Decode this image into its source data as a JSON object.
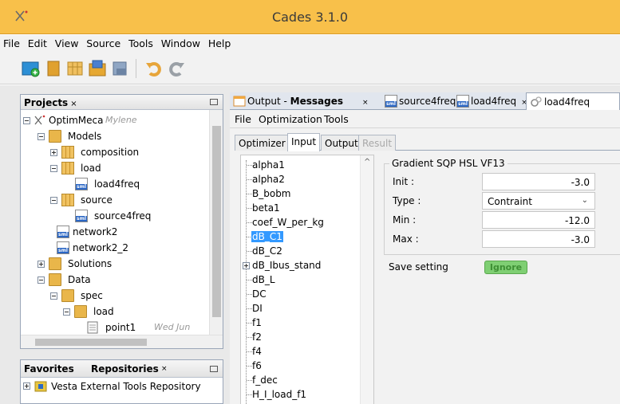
{
  "window": {
    "title": "Cades 3.1.0"
  },
  "menubar": [
    "File",
    "Edit",
    "View",
    "Source",
    "Tools",
    "Window",
    "Help"
  ],
  "projects_panel": {
    "title": "Projects",
    "close_glyph": "×",
    "tree": [
      {
        "label": "OptimMeca",
        "extra": "Mylene"
      },
      {
        "label": "Models"
      },
      {
        "label": "composition"
      },
      {
        "label": "load"
      },
      {
        "label": "load4freq"
      },
      {
        "label": "source"
      },
      {
        "label": "source4freq"
      },
      {
        "label": "network2"
      },
      {
        "label": "network2_2"
      },
      {
        "label": "Solutions"
      },
      {
        "label": "Data"
      },
      {
        "label": "spec"
      },
      {
        "label": "load"
      },
      {
        "label": "point1",
        "extra": "Wed Jun"
      }
    ]
  },
  "favorites_panel": {
    "tabs": [
      "Favorites",
      "Repositories"
    ],
    "items": [
      "Vesta External Tools Repository"
    ]
  },
  "editor_tabs": [
    {
      "prefix": "Output - ",
      "bold": "Messages"
    },
    {
      "label": "source4freq"
    },
    {
      "label": "load4freq"
    },
    {
      "label": "load4freq"
    }
  ],
  "submenu": [
    "File",
    "Optimization",
    "Tools"
  ],
  "optimizer_tabs": [
    {
      "label": "Optimizer"
    },
    {
      "label": "Input"
    },
    {
      "label": "Output"
    },
    {
      "label": "Result"
    }
  ],
  "variables": [
    "alpha1",
    "alpha2",
    "B_bobm",
    "beta1",
    "coef_W_per_kg",
    "dB_C1",
    "dB_C2",
    "dB_Ibus_stand",
    "dB_L",
    "DC",
    "DI",
    "f1",
    "f2",
    "f4",
    "f6",
    "f_dec",
    "H_I_load_f1"
  ],
  "selected_variable": "dB_C1",
  "settings": {
    "group_title": "Gradient SQP HSL VF13",
    "init_label": "Init :",
    "init_value": "-3.0",
    "type_label": "Type :",
    "type_value": "Contraint",
    "min_label": "Min :",
    "min_value": "-12.0",
    "max_label": "Max :",
    "max_value": "-3.0",
    "save_label": "Save setting",
    "save_button": "Ignore"
  },
  "colors": {
    "titlebar": "#f8c04a",
    "selection": "#3399ff",
    "ignore_button": "#7fcf73"
  }
}
